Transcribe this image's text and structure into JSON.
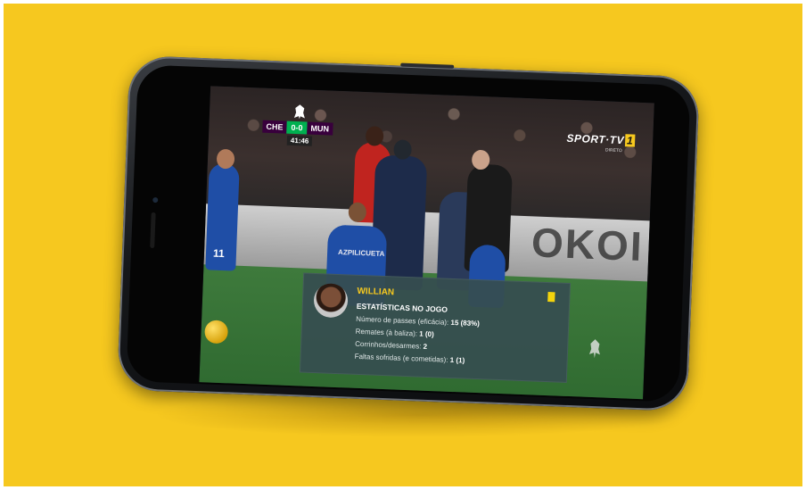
{
  "broadcast": {
    "home_team": "CHE",
    "away_team": "MUN",
    "score": "0-0",
    "clock": "41:46",
    "channel": "SPORT·TV",
    "channel_number": "1",
    "channel_sub": "DIRETO",
    "shirt_name": "AZPILICUETA",
    "shirt_number": "11",
    "board_text": "OKOI"
  },
  "stats_overlay": {
    "player_name": "WILLIAN",
    "section_title": "ESTATÍSTICAS NO JOGO",
    "lines": [
      {
        "label": "Número de passes (eficácia):",
        "value": "15 (83%)"
      },
      {
        "label": "Remates (à baliza):",
        "value": "1 (0)"
      },
      {
        "label": "Corrinhos/desarmes:",
        "value": "2"
      },
      {
        "label": "Faltas sofridas (e cometidas):",
        "value": "1 (1)"
      }
    ],
    "card": "yellow-card-icon"
  },
  "colors": {
    "background": "#f6c81f",
    "overlay": "#364e50",
    "accent_yellow": "#f6c81f",
    "score_green": "#00b050",
    "team_purple": "#38003c"
  }
}
